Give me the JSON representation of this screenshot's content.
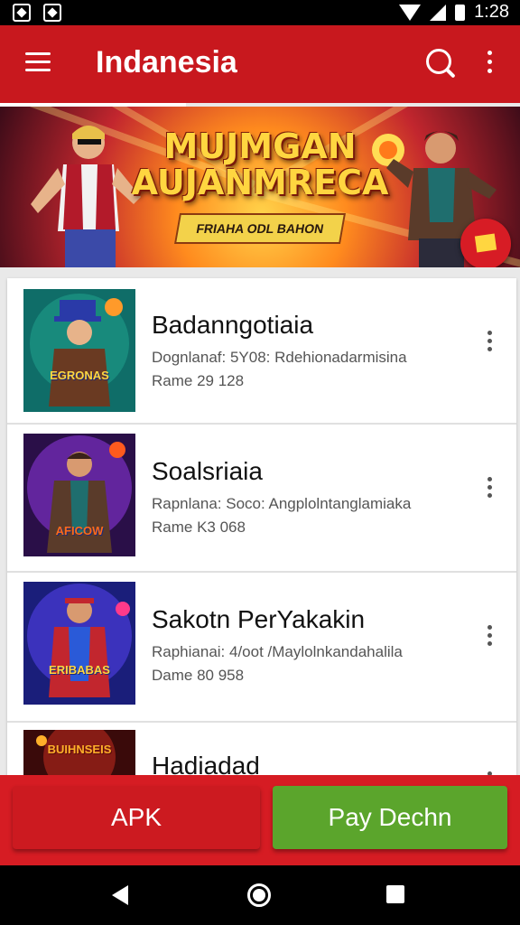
{
  "status_bar": {
    "time": "1:28"
  },
  "app_bar": {
    "title": "Indanesia"
  },
  "banner": {
    "title_line1": "MUJMGAN",
    "title_line2": "AUJANMRECA",
    "subtitle": "FRIAHA ODL BAHON"
  },
  "list": {
    "items": [
      {
        "title": "Badanngotiaia",
        "desc": "Dognlanaf: 5Y08: Rdehionadarmisina",
        "meta": "Rame 29 128",
        "thumb_caption": "EGRONAS",
        "thumb_colors": [
          "#0f6d68",
          "#1e9e8a",
          "#ff9a2a"
        ]
      },
      {
        "title": "Soalsriaia",
        "desc": "Rapnlana: Soco: Angplolntanglamiaka",
        "meta": "Rame K3 068",
        "thumb_caption": "AFICOW",
        "thumb_colors": [
          "#2a0f48",
          "#7a2fc2",
          "#ff5a1e"
        ]
      },
      {
        "title": "Sakotn PerYakakin",
        "desc": "Raphianai: 4/oot /Maylolnkandahalila",
        "meta": "Dame 80 958",
        "thumb_caption": "ERIBABAS",
        "thumb_colors": [
          "#1a1e7a",
          "#4a3ad8",
          "#ff3a8a"
        ]
      },
      {
        "title": "Hadiadad",
        "desc": "",
        "meta": "",
        "thumb_caption": "BUIHNSEIS",
        "thumb_colors": [
          "#3a0a0a",
          "#a6231a",
          "#ffb02a"
        ]
      }
    ]
  },
  "buttons": {
    "apk": "APK",
    "pay": "Pay Dechn"
  },
  "colors": {
    "primary": "#c8181e",
    "accent_green": "#5ba52c"
  }
}
